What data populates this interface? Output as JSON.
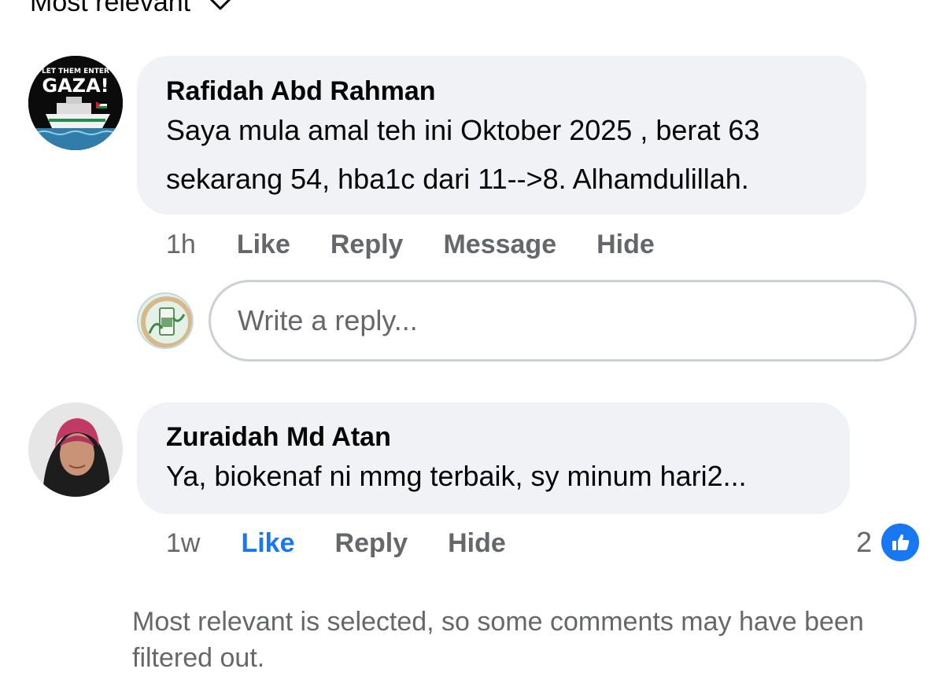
{
  "sort": {
    "label": "Most relevant"
  },
  "comments": [
    {
      "author": "Rafidah Abd Rahman",
      "avatar_text": [
        "LET THEM ENTER",
        "GAZA!"
      ],
      "lines": [
        "Saya mula amal teh ini Oktober 2025 , berat 63",
        "sekarang 54, hba1c dari 11-->8. Alhamdulillah."
      ],
      "time": "1h",
      "actions": [
        "Like",
        "Reply",
        "Message",
        "Hide"
      ]
    },
    {
      "author": "Zuraidah Md Atan",
      "lines": [
        "Ya, biokenaf ni mmg terbaik, sy minum hari2..."
      ],
      "time": "1w",
      "actions": [
        "Like",
        "Reply",
        "Hide"
      ],
      "like_count": "2"
    }
  ],
  "reply": {
    "placeholder": "Write a reply..."
  },
  "notice": "Most relevant is selected, so some comments may have been filtered out.",
  "colors": {
    "accent": "#1877f2",
    "bubble": "#f0f2f5",
    "secondary_text": "#65676b"
  }
}
